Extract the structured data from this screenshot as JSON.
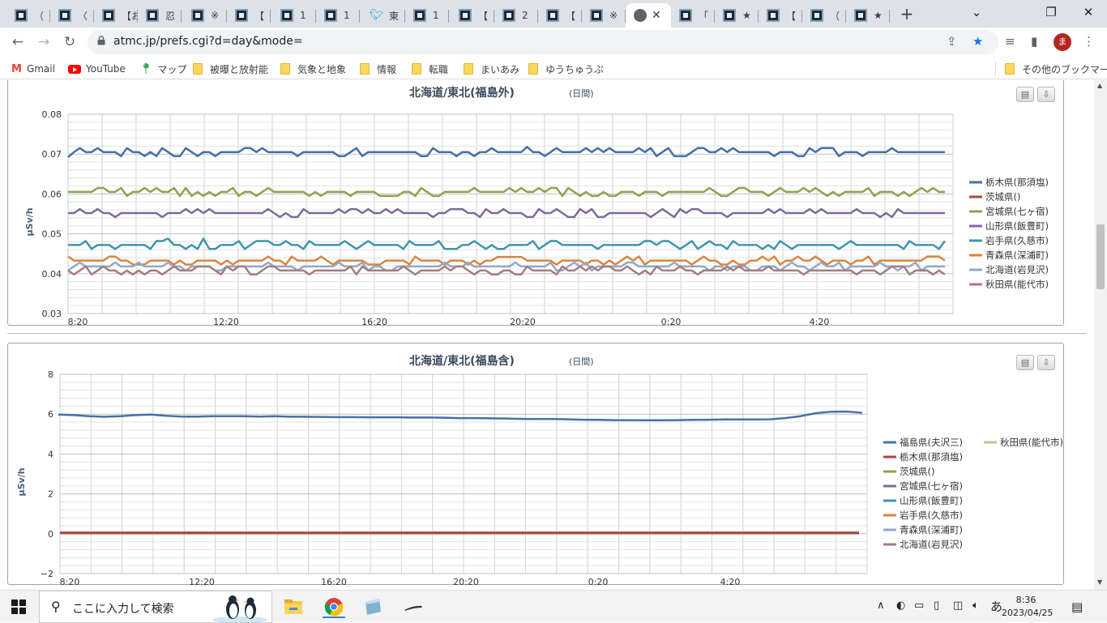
{
  "browser": {
    "tabs": [
      {
        "title": "（",
        "icon": "site-favicon-icon"
      },
      {
        "title": "〈",
        "icon": "site-favicon-icon"
      },
      {
        "title": "【お",
        "icon": "site-favicon-icon"
      },
      {
        "title": "忍",
        "icon": "globe-icon"
      },
      {
        "title": "※",
        "icon": "site-favicon-icon"
      },
      {
        "title": "【",
        "icon": "site-favicon-icon"
      },
      {
        "title": "1",
        "icon": "site-favicon-icon"
      },
      {
        "title": "1",
        "icon": "site-favicon-icon"
      },
      {
        "title": "東",
        "icon": "twitter-icon"
      },
      {
        "title": "1",
        "icon": "site-favicon-icon"
      },
      {
        "title": "【",
        "icon": "site-favicon-icon"
      },
      {
        "title": "2",
        "icon": "site-favicon-icon"
      },
      {
        "title": "【",
        "icon": "site-favicon-icon"
      },
      {
        "title": "※",
        "icon": "site-favicon-icon"
      },
      {
        "title": "",
        "icon": "globe-icon",
        "active": true,
        "close": "✕"
      },
      {
        "title": "「",
        "icon": "site-favicon-icon"
      },
      {
        "title": "★",
        "icon": "site-favicon-icon"
      },
      {
        "title": "【",
        "icon": "site-favicon-icon"
      },
      {
        "title": "（",
        "icon": "site-favicon-icon"
      },
      {
        "title": "★",
        "icon": "site-favicon-icon"
      }
    ],
    "new_tab": "+",
    "url": "atmc.jp/prefs.cgi?d=day&mode=",
    "avatar_letter": "ま",
    "bookmarks": [
      {
        "label": "Gmail",
        "icon": "gmail-icon"
      },
      {
        "label": "YouTube",
        "icon": "youtube-icon"
      },
      {
        "label": "マップ",
        "icon": "maps-icon"
      },
      {
        "label": "被曝と放射能",
        "icon": "folder-icon"
      },
      {
        "label": "気象と地象",
        "icon": "folder-icon"
      },
      {
        "label": "情報",
        "icon": "folder-icon"
      },
      {
        "label": "転職",
        "icon": "folder-icon"
      },
      {
        "label": "まいあみ",
        "icon": "folder-icon"
      },
      {
        "label": "ゆうちゅうぶ",
        "icon": "folder-icon"
      }
    ],
    "other_bookmarks": "その他のブックマーク"
  },
  "charts": {
    "chart1": {
      "title": "北海道/東北(福島外)",
      "subtitle": "(日間)"
    },
    "chart2": {
      "title": "北海道/東北(福島含)",
      "subtitle": "(日間)"
    }
  },
  "chart_data": [
    {
      "type": "line",
      "title": "北海道/東北(福島外)",
      "subtitle": "(日間)",
      "ylabel": "μSv/h",
      "ylim": [
        0.03,
        0.08
      ],
      "yticks": [
        "0.08",
        "0.07",
        "0.06",
        "0.05",
        "0.04",
        "0.03"
      ],
      "xticks": [
        "8:20",
        "12:20",
        "16:20",
        "20:20",
        "0:20",
        "4:20"
      ],
      "legend_position": "right",
      "series": [
        {
          "name": "栃木県(那須塩)",
          "color": "#4572a7",
          "base": 0.0705
        },
        {
          "name": "茨城県()",
          "color": "#aa4643",
          "base": null
        },
        {
          "name": "宮城県(七ヶ宿)",
          "color": "#89a54e",
          "base": 0.0605
        },
        {
          "name": "山形県(飯豊町)",
          "color": "#80699b",
          "base": 0.0552
        },
        {
          "name": "岩手県(久慈市)",
          "color": "#3d96ae",
          "base": 0.0472
        },
        {
          "name": "青森県(深浦町)",
          "color": "#db843d",
          "base": 0.0433
        },
        {
          "name": "北海道(岩見沢)",
          "color": "#92a8cd",
          "base": 0.0418
        },
        {
          "name": "秋田県(能代市)",
          "color": "#a47d7c",
          "base": 0.0408
        }
      ]
    },
    {
      "type": "line",
      "title": "北海道/東北(福島含)",
      "subtitle": "(日間)",
      "ylabel": "μSv/h",
      "ylim": [
        -2,
        8
      ],
      "yticks": [
        "8",
        "6",
        "4",
        "2",
        "0",
        "−2"
      ],
      "xticks": [
        "8:20",
        "12:20",
        "16:20",
        "20:20",
        "0:20",
        "4:20"
      ],
      "legend_position": "right",
      "series": [
        {
          "name": "福島県(夫沢三)",
          "color": "#4572a7"
        },
        {
          "name": "栃木県(那須塩)",
          "color": "#aa4643"
        },
        {
          "name": "茨城県()",
          "color": "#89a54e"
        },
        {
          "name": "宮城県(七ヶ宿)",
          "color": "#80699b"
        },
        {
          "name": "山形県(飯豊町)",
          "color": "#3d96ae"
        },
        {
          "name": "岩手県(久慈市)",
          "color": "#db843d"
        },
        {
          "name": "青森県(深浦町)",
          "color": "#92a8cd"
        },
        {
          "name": "北海道(岩見沢)",
          "color": "#a47d7c"
        },
        {
          "name": "秋田県(能代市)",
          "color": "#b5ca92"
        }
      ],
      "fukushima_values": [
        5.98,
        5.95,
        5.9,
        5.87,
        5.9,
        5.95,
        5.98,
        5.92,
        5.88,
        5.88,
        5.9,
        5.9,
        5.9,
        5.88,
        5.9,
        5.87,
        5.87,
        5.86,
        5.85,
        5.85,
        5.84,
        5.84,
        5.84,
        5.83,
        5.83,
        5.82,
        5.8,
        5.8,
        5.79,
        5.78,
        5.76,
        5.75,
        5.75,
        5.74,
        5.72,
        5.71,
        5.7,
        5.7,
        5.69,
        5.69,
        5.7,
        5.71,
        5.72,
        5.73,
        5.73,
        5.73,
        5.74,
        5.8,
        5.9,
        6.05,
        6.12,
        6.13,
        6.07
      ]
    }
  ],
  "taskbar": {
    "search_placeholder": "ここに入力して検索",
    "time": "8:36",
    "date": "2023/04/25",
    "ime": "あ"
  }
}
